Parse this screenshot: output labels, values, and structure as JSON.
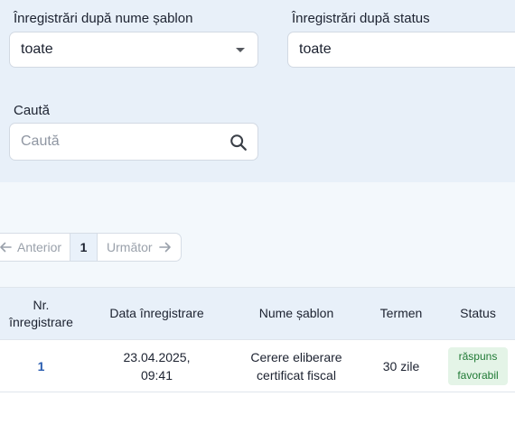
{
  "filters": {
    "template_label": "Înregistrări după nume șablon",
    "template_value": "toate",
    "status_label": "Înregistrări după status",
    "status_value": "toate",
    "search_label": "Caută",
    "search_placeholder": "Caută"
  },
  "pagination": {
    "prev_label": "Anterior",
    "current_page": "1",
    "next_label": "Următor"
  },
  "table": {
    "headers": {
      "nr_line1": "Nr.",
      "nr_line2": "înregistrare",
      "date": "Data înregistrare",
      "template": "Nume șablon",
      "term": "Termen",
      "status": "Status"
    },
    "rows": [
      {
        "nr": "1",
        "date_line1": "23.04.2025,",
        "date_line2": "09:41",
        "template_line1": "Cerere eliberare",
        "template_line2": "certificat fiscal",
        "term": "30 zile",
        "status_line1": "răspuns",
        "status_line2": "favorabil"
      }
    ]
  },
  "colors": {
    "filters_bg": "#e8f0f9",
    "link": "#2a5db0",
    "status_bg": "#e4f4e7",
    "status_text": "#207a35"
  },
  "icons": [
    "chevron-down-icon",
    "search-icon",
    "arrow-left-icon",
    "arrow-right-icon"
  ]
}
